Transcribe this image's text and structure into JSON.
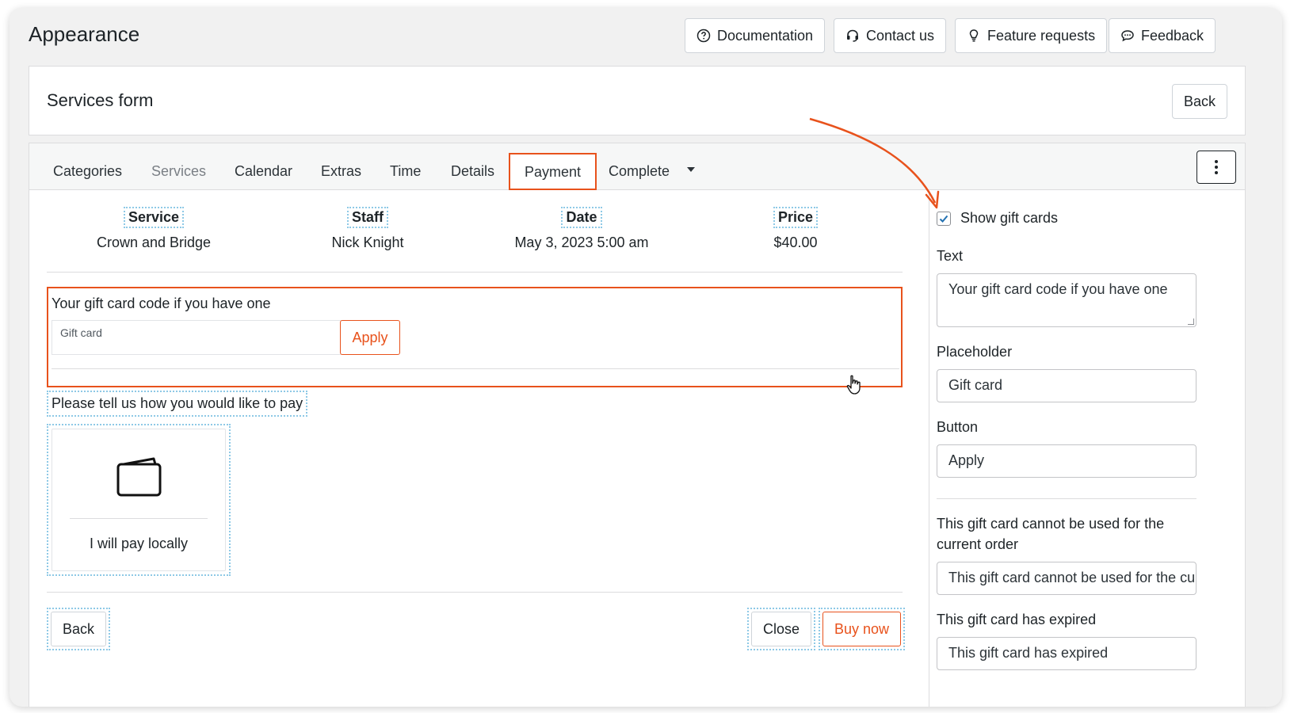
{
  "page": {
    "title": "Appearance"
  },
  "top_buttons": {
    "documentation": "Documentation",
    "contact": "Contact us",
    "feature_requests": "Feature requests",
    "feedback": "Feedback"
  },
  "header_card": {
    "title": "Services form",
    "back_label": "Back"
  },
  "tabs": [
    {
      "label": "Categories",
      "state": "normal"
    },
    {
      "label": "Services",
      "state": "muted"
    },
    {
      "label": "Calendar",
      "state": "normal"
    },
    {
      "label": "Extras",
      "state": "normal"
    },
    {
      "label": "Time",
      "state": "normal"
    },
    {
      "label": "Details",
      "state": "normal"
    },
    {
      "label": "Payment",
      "state": "active"
    },
    {
      "label": "Complete",
      "state": "normal"
    }
  ],
  "summary": {
    "service": {
      "label": "Service",
      "value": "Crown and Bridge"
    },
    "staff": {
      "label": "Staff",
      "value": "Nick Knight"
    },
    "date": {
      "label": "Date",
      "value": "May 3, 2023 5:00 am"
    },
    "price": {
      "label": "Price",
      "value": "$40.00"
    }
  },
  "gift_card": {
    "text": "Your gift card code if you have one",
    "placeholder": "Gift card",
    "button": "Apply"
  },
  "payment": {
    "prompt": "Please tell us how you would like to pay",
    "option_label": "I will pay locally",
    "option_icon": "wallet-icon"
  },
  "footer": {
    "back": "Back",
    "close": "Close",
    "buy_now": "Buy now"
  },
  "sidebar": {
    "show_gift_cards": {
      "label": "Show gift cards",
      "checked": true
    },
    "text": {
      "label": "Text",
      "value": "Your gift card code if you have one"
    },
    "placeholder": {
      "label": "Placeholder",
      "value": "Gift card"
    },
    "button": {
      "label": "Button",
      "value": "Apply"
    },
    "cannot_use": {
      "label": "This gift card cannot be used for the current order",
      "value": "This gift card cannot be used for the current order"
    },
    "expired": {
      "label": "This gift card has expired",
      "value": "This gift card has expired"
    }
  },
  "colors": {
    "accent": "#e8521c",
    "highlight_border": "#8ec9e6",
    "checkbox": "#2271b1"
  }
}
